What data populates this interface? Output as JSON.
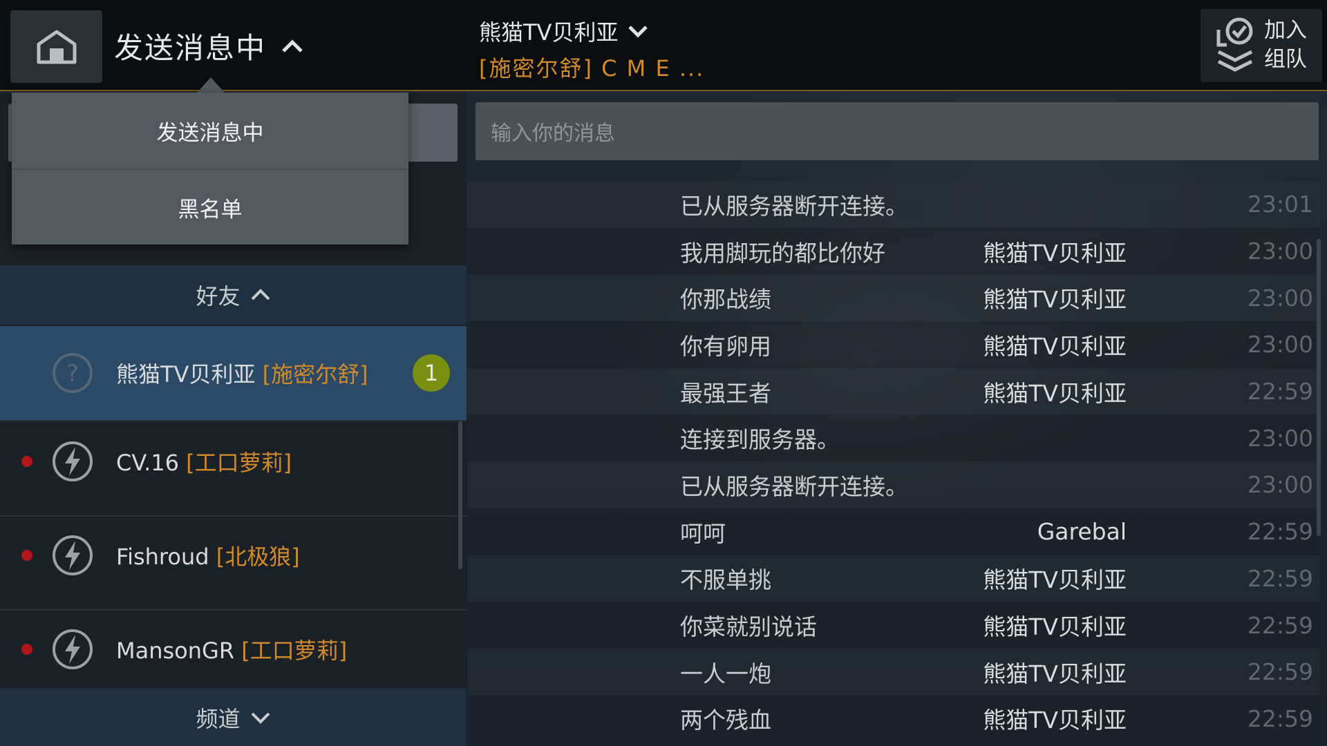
{
  "header": {
    "title": "发送消息中",
    "chat_name": "熊猫TV贝利亚",
    "chat_sub": "[施密尔舒] C M E ...",
    "team_button": {
      "line1": "加入",
      "line2": "组队"
    }
  },
  "dropdown": {
    "items": [
      "发送消息中",
      "黑名单"
    ]
  },
  "sidebar": {
    "friends_header": "好友",
    "channels_header": "频道",
    "friends": [
      {
        "name": "熊猫TV贝利亚",
        "tag": "[施密尔舒]",
        "icon": "question-icon",
        "badge": "1",
        "selected": true
      },
      {
        "name": "CV.16",
        "tag": "[工口萝莉]",
        "icon": "lightning-icon",
        "status": "offline"
      },
      {
        "name": "Fishroud",
        "tag": "[北极狼]",
        "icon": "lightning-icon",
        "status": "offline"
      },
      {
        "name": "MansonGR",
        "tag": "[工口萝莉]",
        "icon": "lightning-icon",
        "status": "offline"
      }
    ]
  },
  "chat": {
    "input_placeholder": "输入你的消息",
    "messages": [
      {
        "sender": "",
        "text": "已从服务器断开连接。",
        "time": "23:01"
      },
      {
        "sender": "熊猫TV贝利亚",
        "text": "我用脚玩的都比你好",
        "time": "23:00"
      },
      {
        "sender": "熊猫TV贝利亚",
        "text": "你那战绩",
        "time": "23:00"
      },
      {
        "sender": "熊猫TV贝利亚",
        "text": "你有卵用",
        "time": "23:00"
      },
      {
        "sender": "熊猫TV贝利亚",
        "text": "最强王者",
        "time": "22:59"
      },
      {
        "sender": "",
        "text": "连接到服务器。",
        "time": "23:00"
      },
      {
        "sender": "",
        "text": "已从服务器断开连接。",
        "time": "23:00"
      },
      {
        "sender": "Garebal",
        "text": "呵呵",
        "time": "22:59"
      },
      {
        "sender": "熊猫TV贝利亚",
        "text": "不服单挑",
        "time": "22:59"
      },
      {
        "sender": "熊猫TV贝利亚",
        "text": "你菜就别说话",
        "time": "22:59"
      },
      {
        "sender": "熊猫TV贝利亚",
        "text": "一人一炮",
        "time": "22:59"
      },
      {
        "sender": "熊猫TV贝利亚",
        "text": "两个残血",
        "time": "22:59"
      }
    ]
  },
  "colors": {
    "accent_orange": "#d08a2a",
    "selected_row": "#2c4a66",
    "badge_green": "#7a8f12",
    "status_offline_red": "#b0161a"
  }
}
